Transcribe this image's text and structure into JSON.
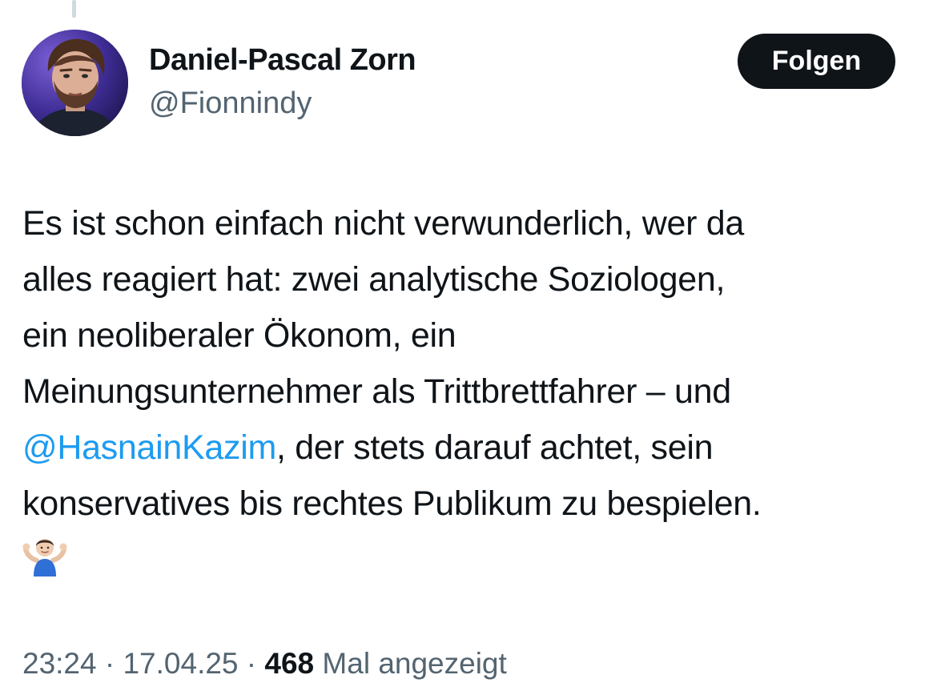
{
  "author": {
    "name": "Daniel-Pascal Zorn",
    "handle": "@Fionnindy",
    "avatar_icon": "profile-photo-avatar"
  },
  "follow_button": {
    "label": "Folgen"
  },
  "tweet": {
    "line1": "Es ist schon einfach nicht verwunderlich, wer da",
    "line2": "alles reagiert hat: zwei analytische Soziologen,",
    "line3": "ein neoliberaler Ökonom, ein",
    "line4": "Meinungsunternehmer als Trittbrettfahrer – und",
    "mention": "@HasnainKazim",
    "line5_rest": ", der stets darauf achtet, sein",
    "line6": "konservatives bis rechtes Publikum zu bespielen.",
    "emoji": "man-shrugging-emoji"
  },
  "meta": {
    "time": "23:24",
    "separator1": " · ",
    "date": "17.04.25",
    "separator2": " · ",
    "views_count": "468",
    "views_label": " Mal angezeigt"
  },
  "colors": {
    "text": "#0f1419",
    "secondary": "#536471",
    "mention": "#1d9bf0",
    "button_bg": "#0f1419",
    "button_text": "#ffffff"
  }
}
